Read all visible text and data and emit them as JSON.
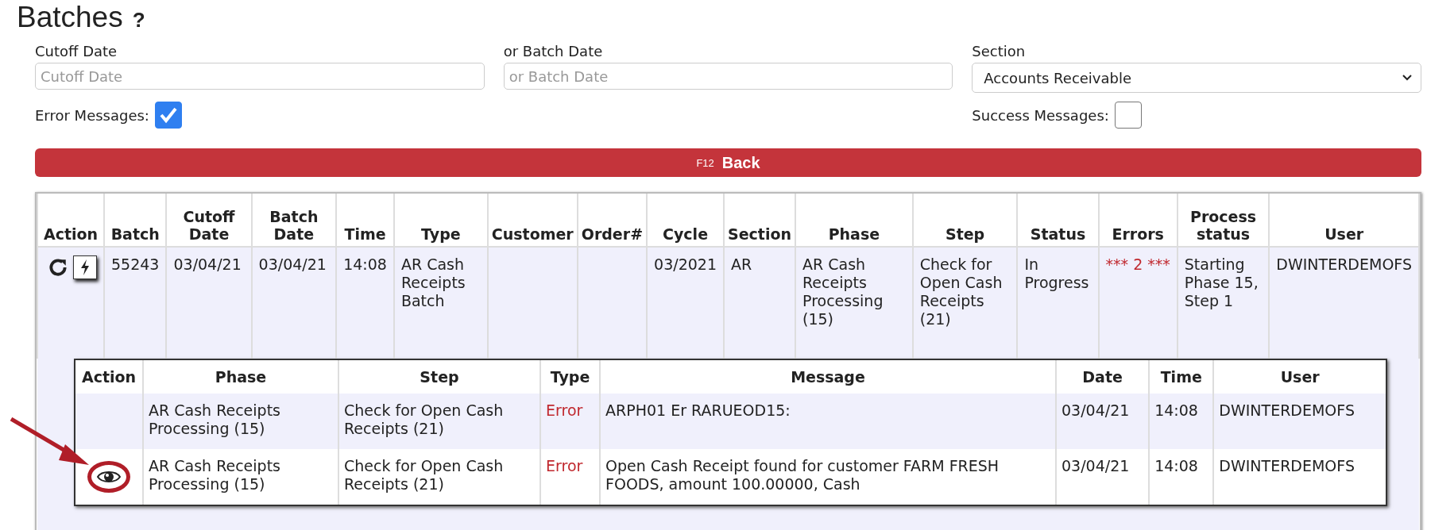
{
  "page": {
    "title": "Batches",
    "help": "?"
  },
  "filters": {
    "fields": [
      {
        "label": "Cutoff Date",
        "placeholder": "Cutoff Date"
      },
      {
        "label": "or Batch Date",
        "placeholder": "or Batch Date"
      }
    ],
    "section": {
      "label": "Section",
      "value": "Accounts Receivable"
    },
    "checkboxes": [
      {
        "label": "Error Messages:",
        "checked": true
      },
      {
        "label": "Success Messages:",
        "checked": false
      }
    ]
  },
  "back_button": {
    "key": "F12",
    "label": "Back"
  },
  "batches": {
    "columns": [
      "Action",
      "Batch",
      "Cutoff Date",
      "Batch Date",
      "Time",
      "Type",
      "Customer",
      "Order#",
      "Cycle",
      "Section",
      "Phase",
      "Step",
      "Status",
      "Errors",
      "Process status",
      "User"
    ],
    "rows": [
      {
        "batch": "55243",
        "cutoff_date": "03/04/21",
        "batch_date": "03/04/21",
        "time": "14:08",
        "type": "AR Cash Receipts Batch",
        "cycle": "03/2021",
        "section": "AR",
        "phase": "AR Cash Receipts Processing (15)",
        "step": "Check for Open Cash Receipts (21)",
        "status": "In Progress",
        "errors": "*** 2 ***",
        "process_status": "Starting Phase 15, Step 1",
        "user": "DWINTERDEMOFS",
        "messages": {
          "columns": [
            "Action",
            "Phase",
            "Step",
            "Type",
            "Message",
            "Date",
            "Time",
            "User"
          ],
          "rows": [
            {
              "has_view": false,
              "phase": "AR Cash Receipts Processing (15)",
              "step": "Check for Open Cash Receipts (21)",
              "type": "Error",
              "kind": "error",
              "message": "ARPH01 Er RARUEOD15:",
              "date": "03/04/21",
              "time": "14:08",
              "user": "DWINTERDEMOFS"
            },
            {
              "has_view": true,
              "highlighted": true,
              "phase": "AR Cash Receipts Processing (15)",
              "step": "Check for Open Cash Receipts (21)",
              "type": "Error",
              "kind": "error",
              "message": "Open Cash Receipt found for customer FARM FRESH FOODS, amount 100.00000, Cash",
              "date": "03/04/21",
              "time": "14:08",
              "user": "DWINTERDEMOFS"
            }
          ]
        }
      }
    ]
  }
}
